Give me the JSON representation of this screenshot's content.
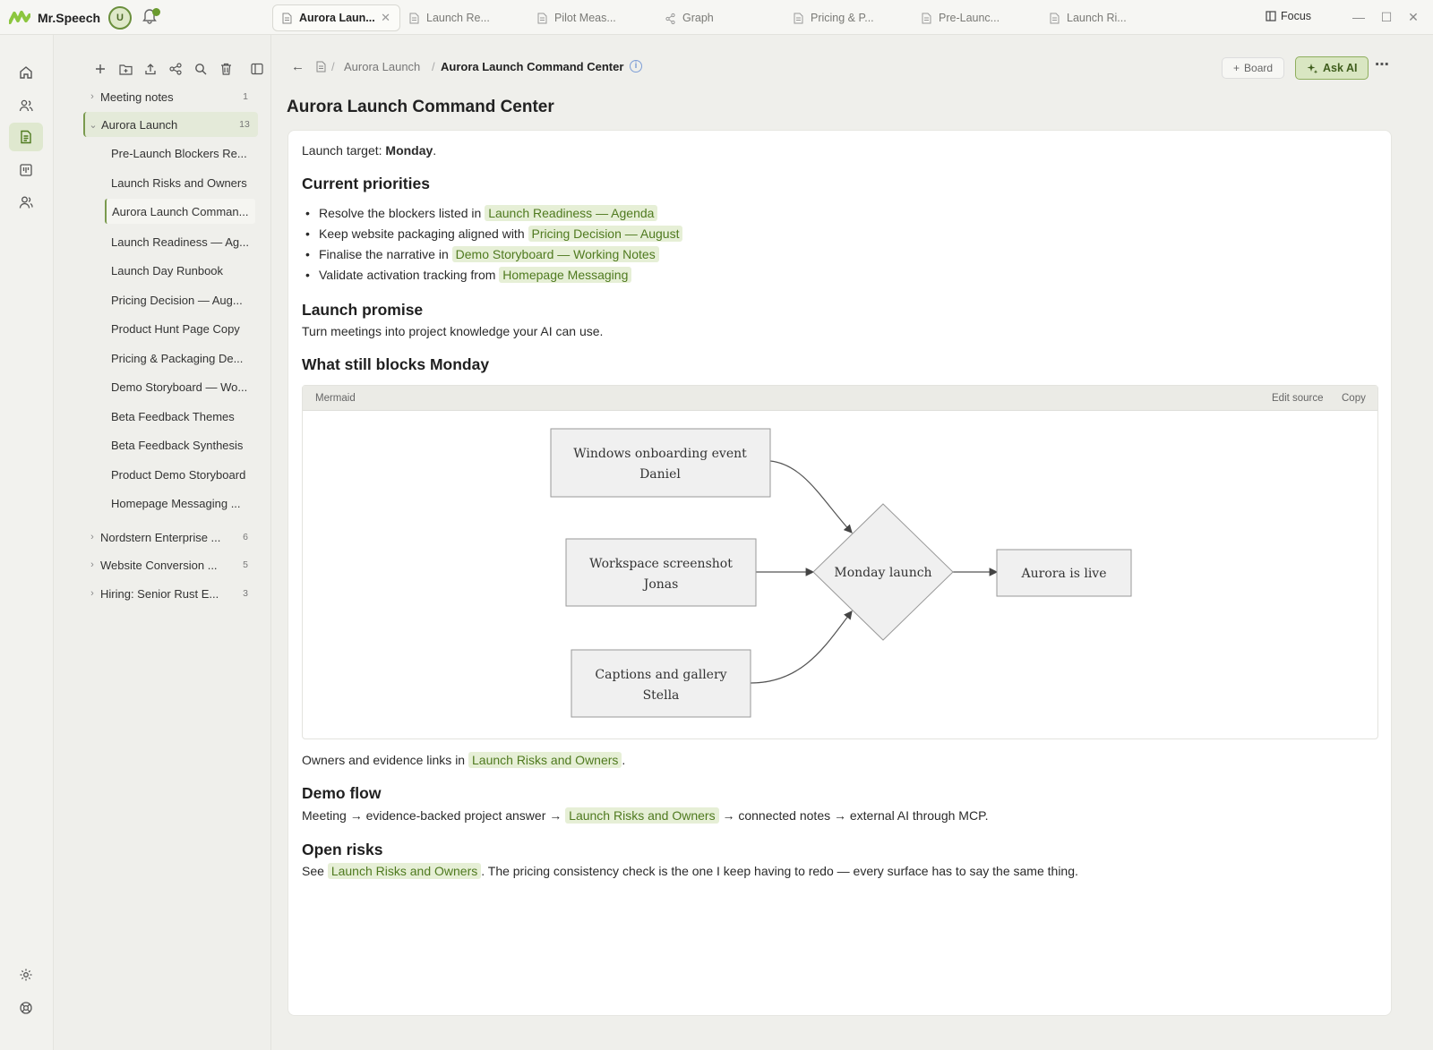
{
  "app": {
    "name": "Mr.Speech",
    "user_initial": "U",
    "accent": "#6a9a2e"
  },
  "tabs": [
    {
      "label": "Aurora Laun...",
      "active": true
    },
    {
      "label": "Launch Re...",
      "active": false
    },
    {
      "label": "Pilot Meas...",
      "active": false
    },
    {
      "label": "Graph",
      "active": false
    },
    {
      "label": "Pricing & P...",
      "active": false
    },
    {
      "label": "Pre-Launc...",
      "active": false
    },
    {
      "label": "Launch Ri...",
      "active": false
    }
  ],
  "titlebar": {
    "focus_label": "Focus"
  },
  "sidebar": {
    "folders": [
      {
        "label": "Meeting notes",
        "count": "1"
      },
      {
        "label": "Aurora Launch",
        "count": "13"
      },
      {
        "label": "Nordstern Enterprise ...",
        "count": "6"
      },
      {
        "label": "Website Conversion ...",
        "count": "5"
      },
      {
        "label": "Hiring: Senior Rust E...",
        "count": "3"
      }
    ],
    "items": [
      "Pre-Launch Blockers Re...",
      "Launch Risks and Owners",
      "Aurora Launch Comman...",
      "Launch Readiness — Ag...",
      "Launch Day Runbook",
      "Pricing Decision — Aug...",
      "Product Hunt Page Copy",
      "Pricing & Packaging De...",
      "Demo Storyboard — Wo...",
      "Beta Feedback Themes",
      "Beta Feedback Synthesis",
      "Product Demo Storyboard",
      "Homepage Messaging ..."
    ]
  },
  "breadcrumb": {
    "sep": "/",
    "parent": "Aurora Launch",
    "current": "Aurora Launch Command Center"
  },
  "actions": {
    "board": "Board",
    "ask_ai": "Ask AI"
  },
  "doc": {
    "title": "Aurora Launch Command Center",
    "target_prefix": "Launch target: ",
    "target_value": "Monday",
    "target_suffix": ".",
    "priorities_heading": "Current priorities",
    "priorities": [
      {
        "text": "Resolve the blockers listed in ",
        "link": "Launch Readiness — Agenda"
      },
      {
        "text": "Keep website packaging aligned with ",
        "link": "Pricing Decision — August"
      },
      {
        "text": "Finalise the narrative in ",
        "link": "Demo Storyboard — Working Notes"
      },
      {
        "text": "Validate activation tracking from ",
        "link": "Homepage Messaging"
      }
    ],
    "promise_heading": "Launch promise",
    "promise_text": "Turn meetings into project knowledge your AI can use.",
    "blocks_heading": "What still blocks Monday",
    "mermaid": {
      "title": "Mermaid",
      "edit": "Edit source",
      "copy": "Copy",
      "nodes": {
        "n1_l1": "Windows onboarding event",
        "n1_l2": "Daniel",
        "n2_l1": "Workspace screenshot",
        "n2_l2": "Jonas",
        "n3_l1": "Captions and gallery",
        "n3_l2": "Stella",
        "decision": "Monday launch",
        "result": "Aurora is live"
      }
    },
    "owners_text": "Owners and evidence links in ",
    "owners_link": "Launch Risks and Owners",
    "owners_end": ".",
    "demo_heading": "Demo flow",
    "demo_pre": "Meeting → evidence-backed project answer → ",
    "demo_link": "Launch Risks and Owners",
    "demo_post": " → connected notes → external AI through MCP.",
    "risks_heading": "Open risks",
    "risks_pre": "See ",
    "risks_link": "Launch Risks and Owners",
    "risks_post": ". The pricing consistency check is the one I keep having to redo — every surface has to say the same thing."
  }
}
